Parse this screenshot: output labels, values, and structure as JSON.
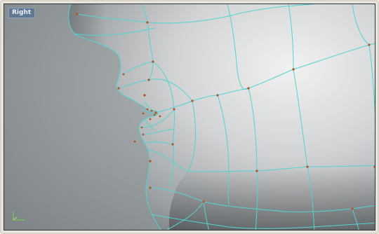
{
  "viewport": {
    "label": "Right",
    "background_color": "#8f9598",
    "wire_color": "#52d4d4",
    "vertex_color": "#b8501f"
  },
  "icons": {
    "axis": "axis-gizmo-icon"
  }
}
